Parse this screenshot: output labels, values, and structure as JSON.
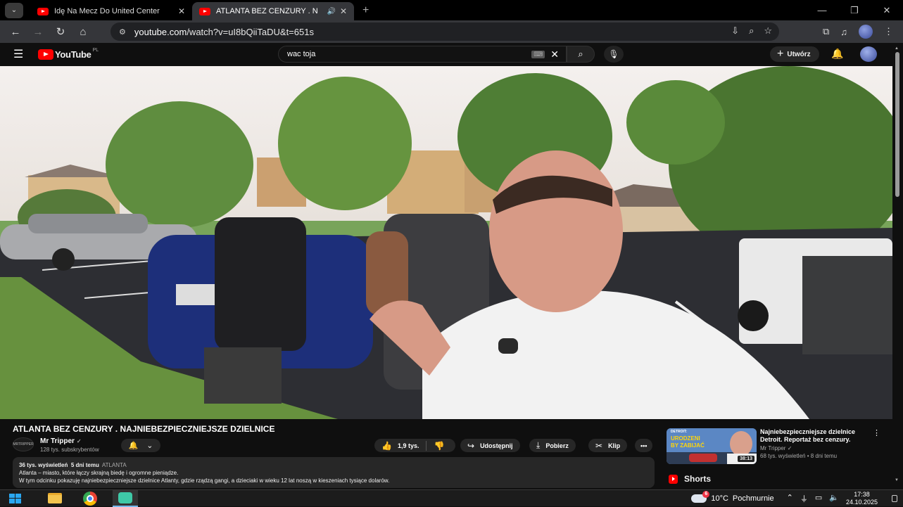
{
  "browser": {
    "tabs": [
      {
        "title": "Idę Na Mecz Do United Center",
        "active": false
      },
      {
        "title": "ATLANTA BEZ CENZURY . N",
        "active": true
      }
    ],
    "url_host": "youtube.com",
    "url_path": "/watch?v=uI8bQiiTaDU&t=651s"
  },
  "youtube": {
    "logo": "YouTube",
    "region": "PL",
    "search_query": "wac toja",
    "create_label": "Utwórz"
  },
  "video": {
    "title": "ATLANTA BEZ CENZURY . NAJNIEBEZPIECZNIEJSZE DZIELNICE",
    "channel_badge": "MRTRIPPER",
    "channel": "Mr Tripper",
    "subscribers": "128 tys. subskrybentów",
    "likes": "1,9 tys.",
    "share": "Udostępnij",
    "download": "Pobierz",
    "clip": "Klip",
    "views": "36 tys. wyświetleń",
    "age": "5 dni temu",
    "tag": "ATLANTA",
    "description": [
      "Atlanta – miasto, które łączy skrajną biedę i ogromne pieniądze.",
      "W tym odcinku pokazuję najniebezpieczniejsze dzielnice Atlanty, gdzie rządzą gangi, a dzieciaki w wieku 12 lat noszą w kieszeniach tysiące dolarów."
    ]
  },
  "recommended": {
    "title": "Najniebezpieczniejsze dzielnice Detroit. Reportaż bez cenzury.",
    "channel": "Mr Tripper",
    "views": "68 tys. wyświetleń",
    "age": "8 dni temu",
    "duration": "38:13",
    "thumb_text": [
      "DETROIT:",
      "URODZENI",
      "BY ZABIJAĆ"
    ]
  },
  "shorts_label": "Shorts",
  "taskbar": {
    "temperature": "10°C",
    "weather": "Pochmurnie",
    "weather_badge": "6",
    "time": "17:38",
    "date": "24.10.2025"
  },
  "colors": {
    "accent": "#ff0000",
    "bg": "#0f0f0f",
    "chip": "#272727"
  }
}
